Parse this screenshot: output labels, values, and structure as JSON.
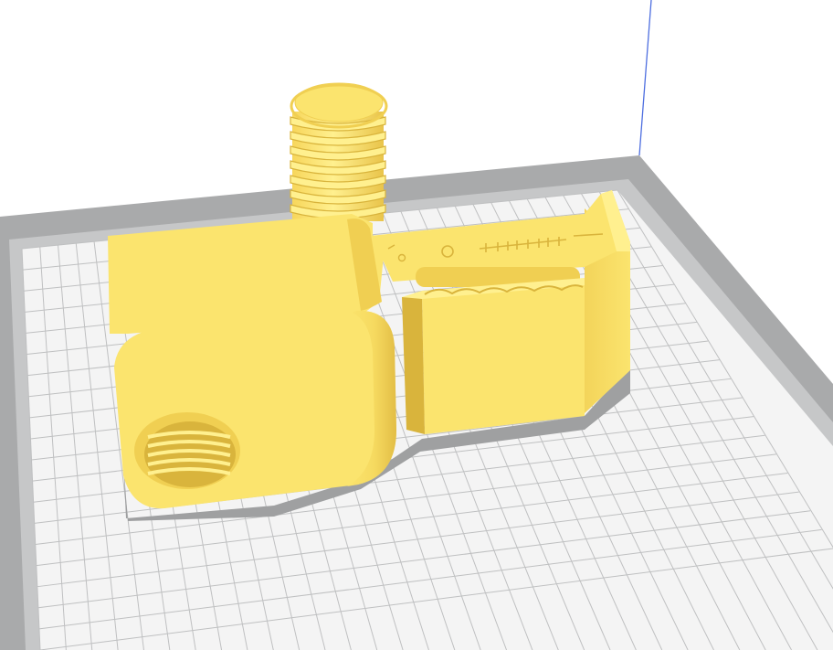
{
  "scene": {
    "background_color": "#ffffff",
    "build_plate": {
      "border_color": "#a9aaab",
      "inner_border_color": "#c6c7c8",
      "surface_color": "#f4f4f4",
      "grid_line_color": "#bfc0c1"
    },
    "build_volume_edge_color": "#4d6ee0",
    "model": {
      "color": "#fbe46e",
      "shade_color": "#f0cf52",
      "dark_shade_color": "#d9b43c",
      "highlight_color": "#fff08f",
      "shadow_color": "#9fa0a1"
    },
    "icons": [
      "build-plate-icon",
      "model-mesh-icon"
    ]
  }
}
